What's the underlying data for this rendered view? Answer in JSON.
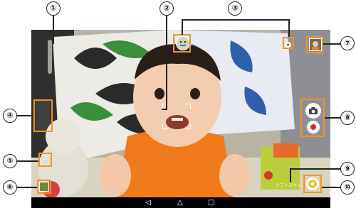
{
  "callouts": [
    "①",
    "②",
    "③",
    "④",
    "⑤",
    "⑥",
    "⑦",
    "⑧",
    "⑨",
    "⑩"
  ],
  "camera": {
    "zoom_slider": "zoom-slider",
    "focus_frame": "focus-frame",
    "scene_icon": "smile-face-icon",
    "location_icon": "location-pin-icon",
    "recent_photo": "recent-photo-thumbnail",
    "photo_button_icon": "camera-icon",
    "video_button_icon": "record-icon",
    "mode_label": "ソフトスナップ",
    "mode_button_icon": "soft-snap-icon",
    "settings_icon": "settings-icon",
    "left_panel": "left-edge-panel",
    "accent_color": "#f29420"
  },
  "navbar": {
    "back": "◁",
    "home": "△",
    "recents": "□"
  }
}
